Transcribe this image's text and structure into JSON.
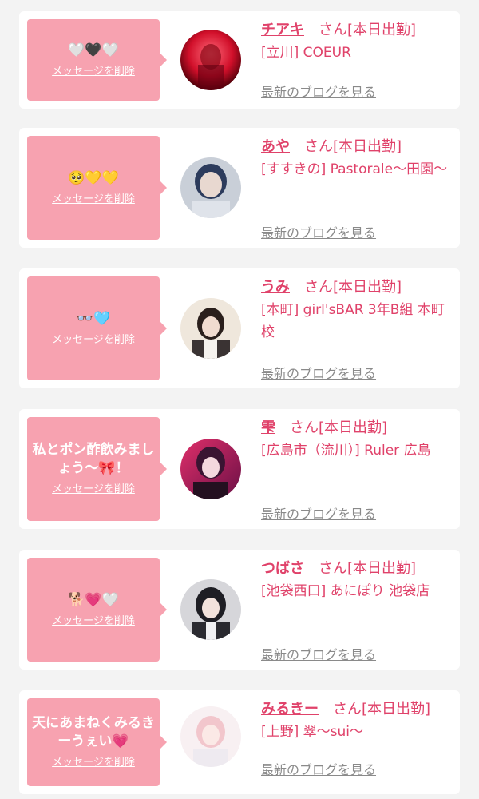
{
  "delete_label": "メッセージを削除",
  "san_label": "さん",
  "blog_label": "最新のブログを見る",
  "colors": {
    "accent": "#e0426a",
    "bubble": "#f7a2b0",
    "background": "#f3f3f3",
    "link_gray": "#8a8a8a"
  },
  "cards": [
    {
      "message": "🤍🖤🤍",
      "name": "チアキ",
      "status": "[本日出勤]",
      "shop": "[立川] COEUR"
    },
    {
      "message": "🥺💛💛",
      "name": "あや",
      "status": "[本日出勤]",
      "shop": "[すすきの] Pastorale〜田園〜"
    },
    {
      "message": "👓🩵",
      "name": "うみ",
      "status": "[本日出勤]",
      "shop": "[本町] girl'sBAR 3年B組 本町校"
    },
    {
      "message": "私とポン酢飲みましょう〜🎀！",
      "name": "雫",
      "status": "[本日出勤]",
      "shop": "[広島市（流川）] Ruler 広島"
    },
    {
      "message": "🐕💗🤍",
      "name": "つばさ",
      "status": "[本日出勤]",
      "shop": "[池袋西口] あにぽり 池袋店"
    },
    {
      "message": "天にあまねくみるきーうぇい💗",
      "name": "みるきー",
      "status": "[本日出勤]",
      "shop": "[上野] 翠〜sui〜"
    }
  ]
}
